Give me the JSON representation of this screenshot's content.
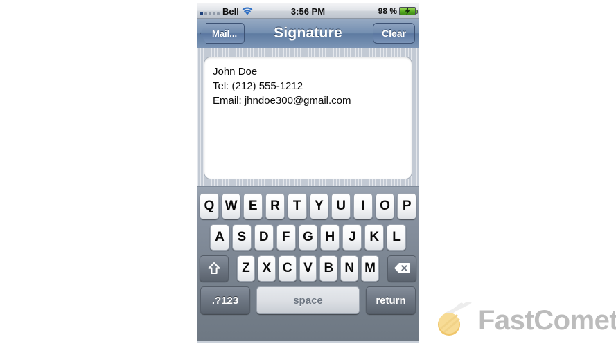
{
  "status_bar": {
    "signal_icon": "signal-bars-icon",
    "signal_bars_active": 1,
    "signal_bars_total": 5,
    "carrier": "Bell",
    "wifi_icon": "wifi-icon",
    "time": "3:56 PM",
    "battery_percent": "98 %",
    "battery_icon": "battery-charging-icon"
  },
  "nav_bar": {
    "back_label": "Mail...",
    "title": "Signature",
    "clear_label": "Clear"
  },
  "signature": {
    "lines": [
      "John Doe",
      "Tel: (212) 555-1212",
      "Email: jhndoe300@gmail.com"
    ]
  },
  "keyboard": {
    "row1": [
      "Q",
      "W",
      "E",
      "R",
      "T",
      "Y",
      "U",
      "I",
      "O",
      "P"
    ],
    "row2": [
      "A",
      "S",
      "D",
      "F",
      "G",
      "H",
      "J",
      "K",
      "L"
    ],
    "row3": [
      "Z",
      "X",
      "C",
      "V",
      "B",
      "N",
      "M"
    ],
    "shift_icon": "shift-arrow-icon",
    "backspace_icon": "backspace-delete-icon",
    "numeric_label": ".?123",
    "space_label": "space",
    "return_label": "return"
  },
  "watermark": {
    "logo_icon": "comet-icon",
    "text": "FastComet"
  },
  "colors": {
    "nav_blue": "#6f8aad",
    "keyboard_gray": "#79838f",
    "key_white": "#f7f8f9",
    "battery_green": "#57ad22",
    "watermark_gray": "#b7b7b7",
    "comet_yellow": "#f5cf74"
  }
}
